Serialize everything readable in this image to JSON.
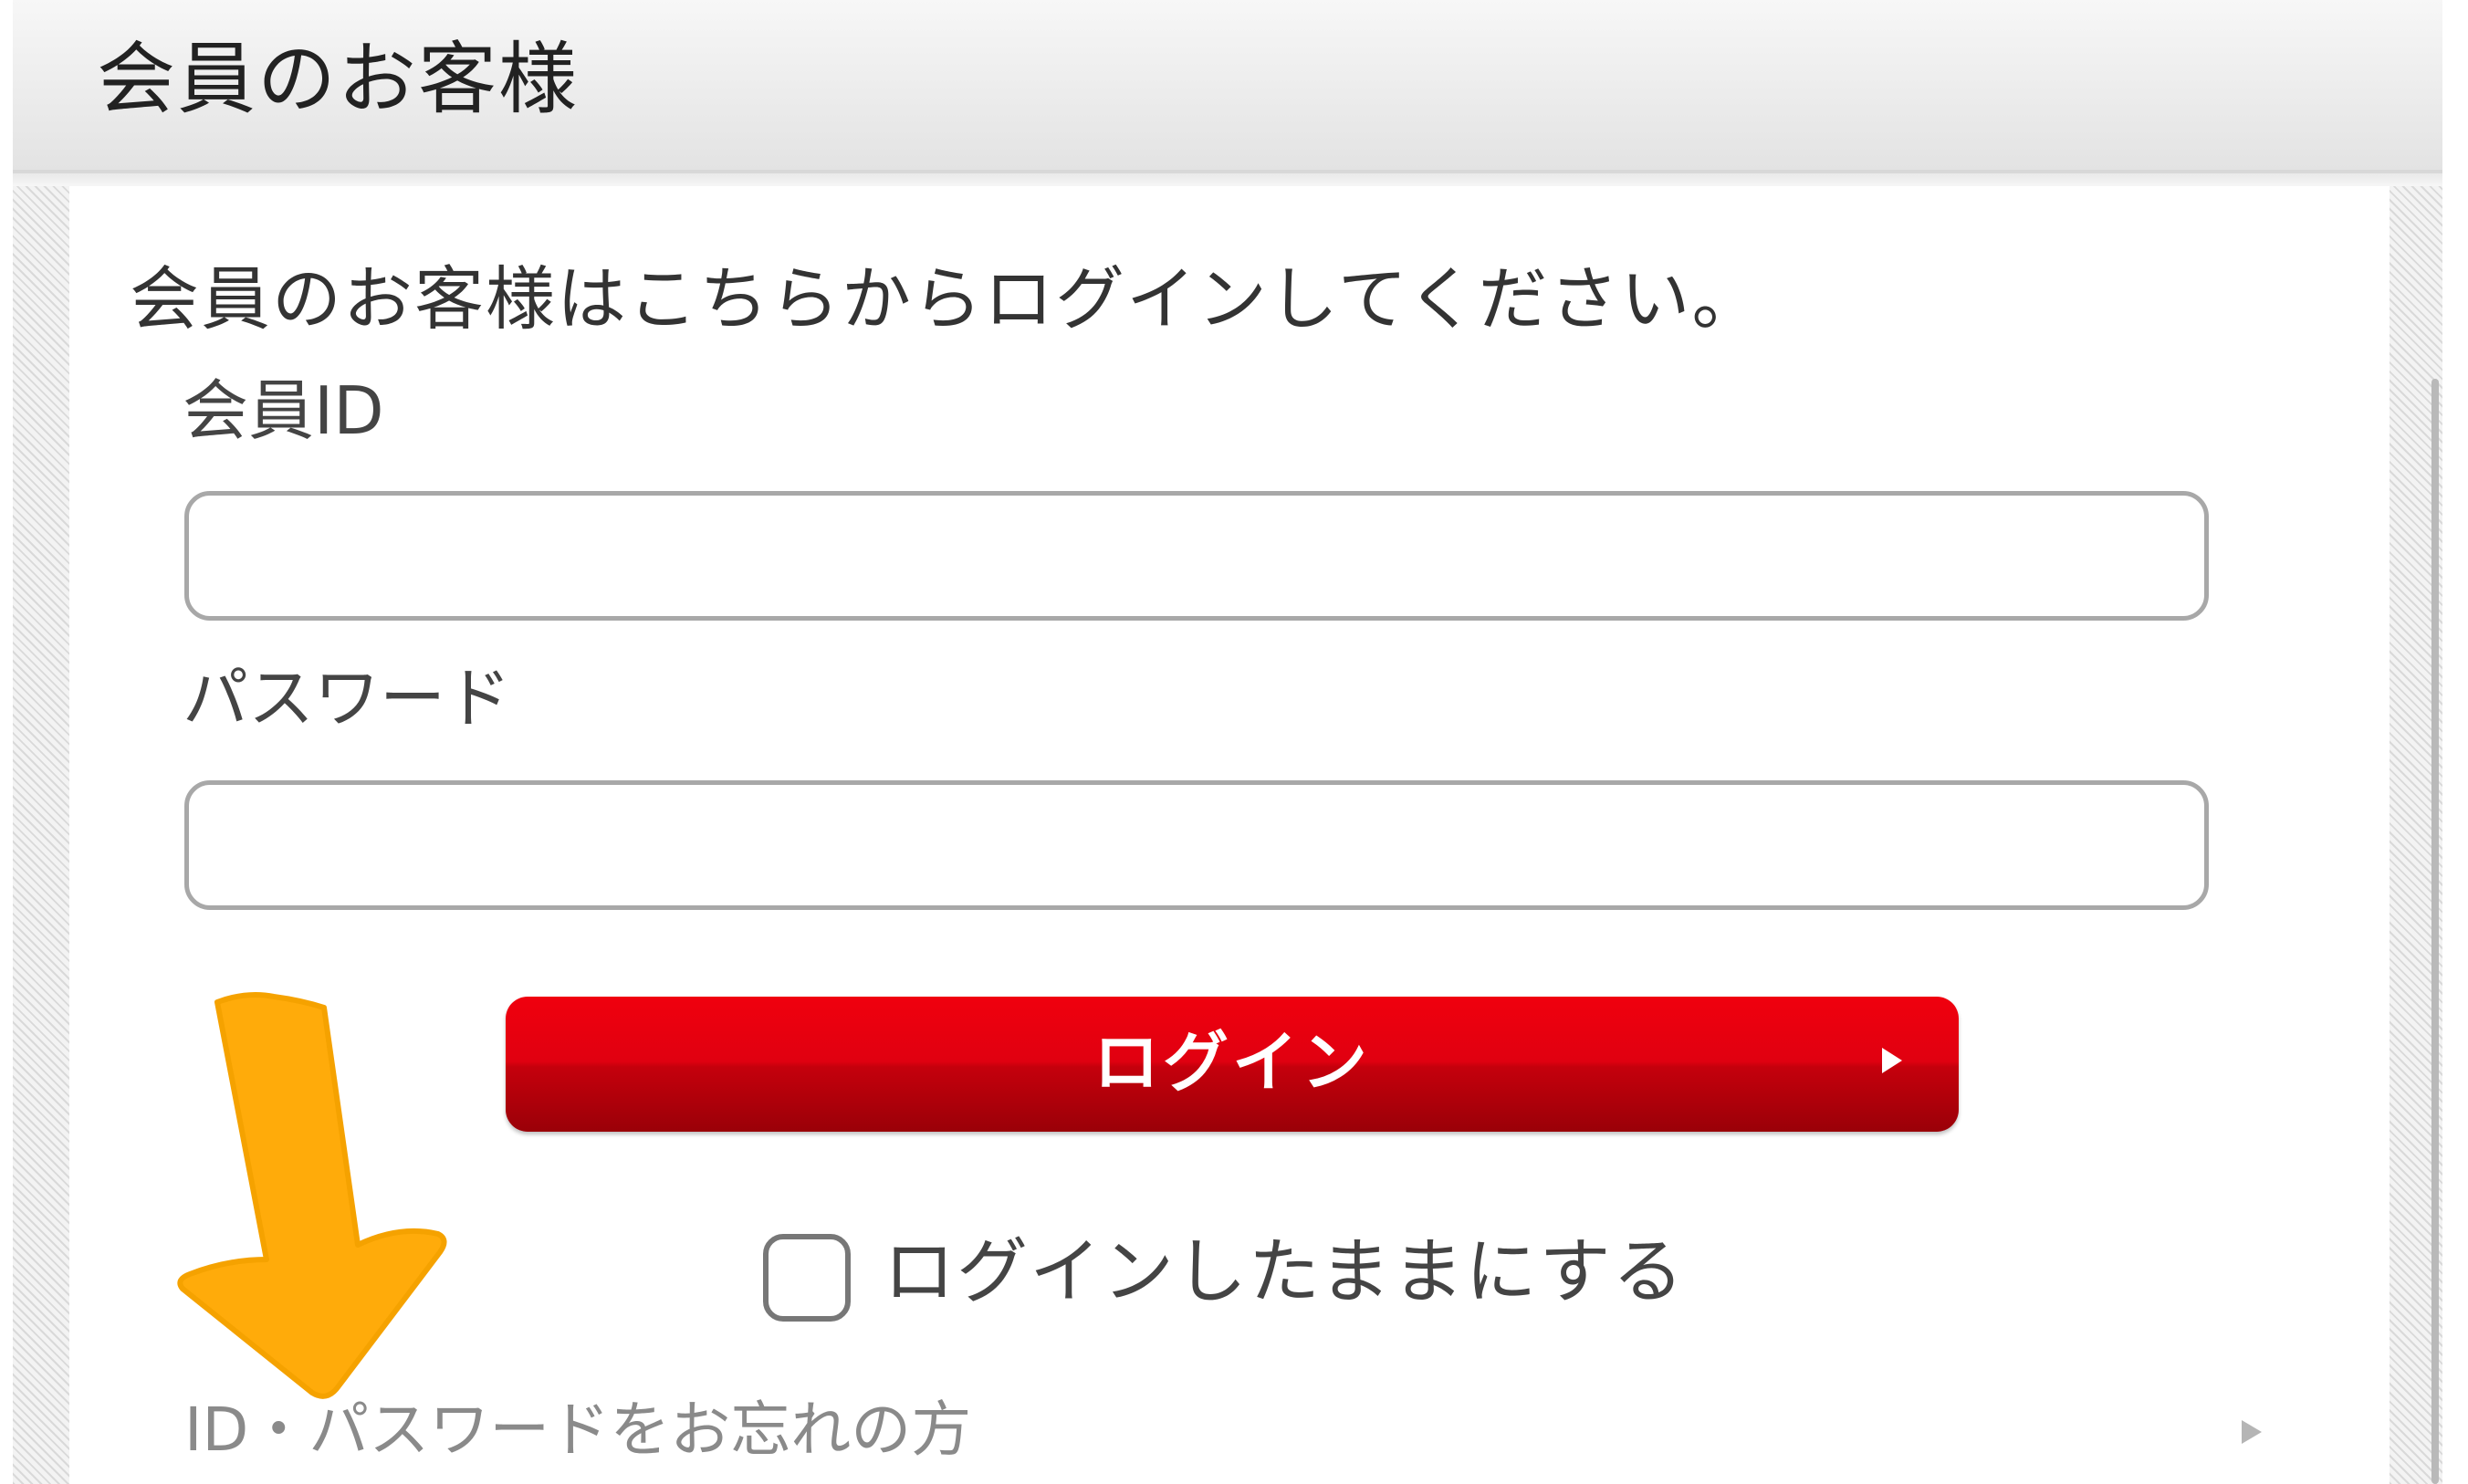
{
  "header": {
    "title": "会員のお客様"
  },
  "login_form": {
    "intro": "会員のお客様はこちらからログインしてください。",
    "member_id_label": "会員ID",
    "member_id_value": "",
    "password_label": "パスワード",
    "password_value": "",
    "login_button_label": "ログイン",
    "stay_logged_in_label": "ログインしたままにする",
    "stay_logged_in_checked": false,
    "forgot_link_label": "ID・パスワードをお忘れの方"
  },
  "icons": {
    "login_arrow": "play-arrow-icon",
    "forgot_arrow": "play-arrow-icon",
    "annotation": "down-arrow-annotation"
  },
  "colors": {
    "login_button": "#e00010",
    "annotation_arrow": "#ffab0a",
    "header_bg": "#eeeeee"
  }
}
